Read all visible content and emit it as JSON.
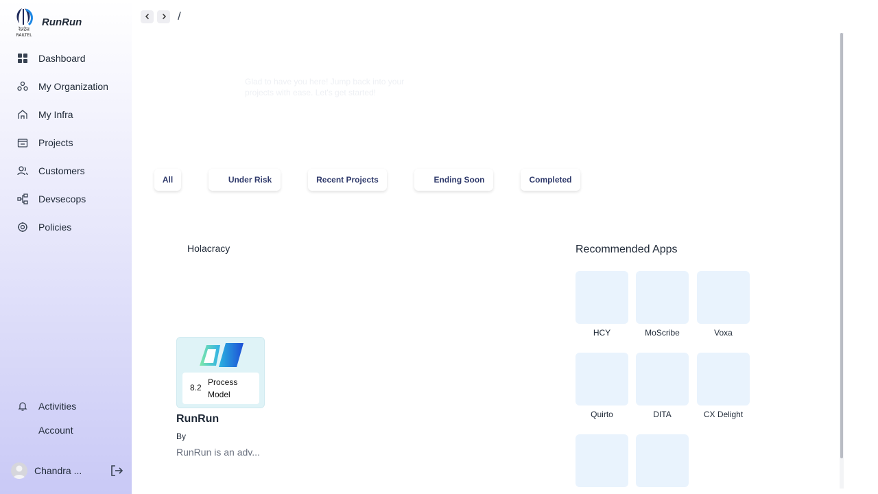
{
  "sidebar": {
    "brand": "RunRun",
    "logo_caption": "रेलटेल\nRAILTEL",
    "items": [
      {
        "label": "Dashboard",
        "icon": "grid-icon"
      },
      {
        "label": "My Organization",
        "icon": "org-icon"
      },
      {
        "label": "My Infra",
        "icon": "infra-icon"
      },
      {
        "label": "Projects",
        "icon": "projects-icon"
      },
      {
        "label": "Customers",
        "icon": "customers-icon"
      },
      {
        "label": "Devsecops",
        "icon": "devsecops-icon"
      },
      {
        "label": "Policies",
        "icon": "policies-icon"
      }
    ],
    "bottom_items": [
      {
        "label": "Activities",
        "icon": "bell-icon"
      },
      {
        "label": "Account",
        "icon": ""
      }
    ],
    "user_name": "Chandra ..."
  },
  "header": {
    "breadcrumb": "/"
  },
  "welcome": "Glad to have you here! Jump back into your projects with ease. Let's get started!",
  "tabs": [
    "All",
    "Under Risk",
    "Recent Projects",
    "Ending Soon",
    "Completed"
  ],
  "holacracy": {
    "title": "Holacracy",
    "card": {
      "score": "8.2",
      "label": "Process Model",
      "name": "RunRun",
      "by": "By",
      "description": "RunRun is an adv..."
    }
  },
  "recommended": {
    "title": "Recommended Apps",
    "apps": [
      "HCY",
      "MoScribe",
      "Voxa",
      "Quirto",
      "DITA",
      "CX Delight",
      "",
      ""
    ]
  },
  "colors": {
    "accent": "#2f3a6b",
    "app_tile": "#e9f3fd",
    "card_bg": "#dff3f7"
  }
}
